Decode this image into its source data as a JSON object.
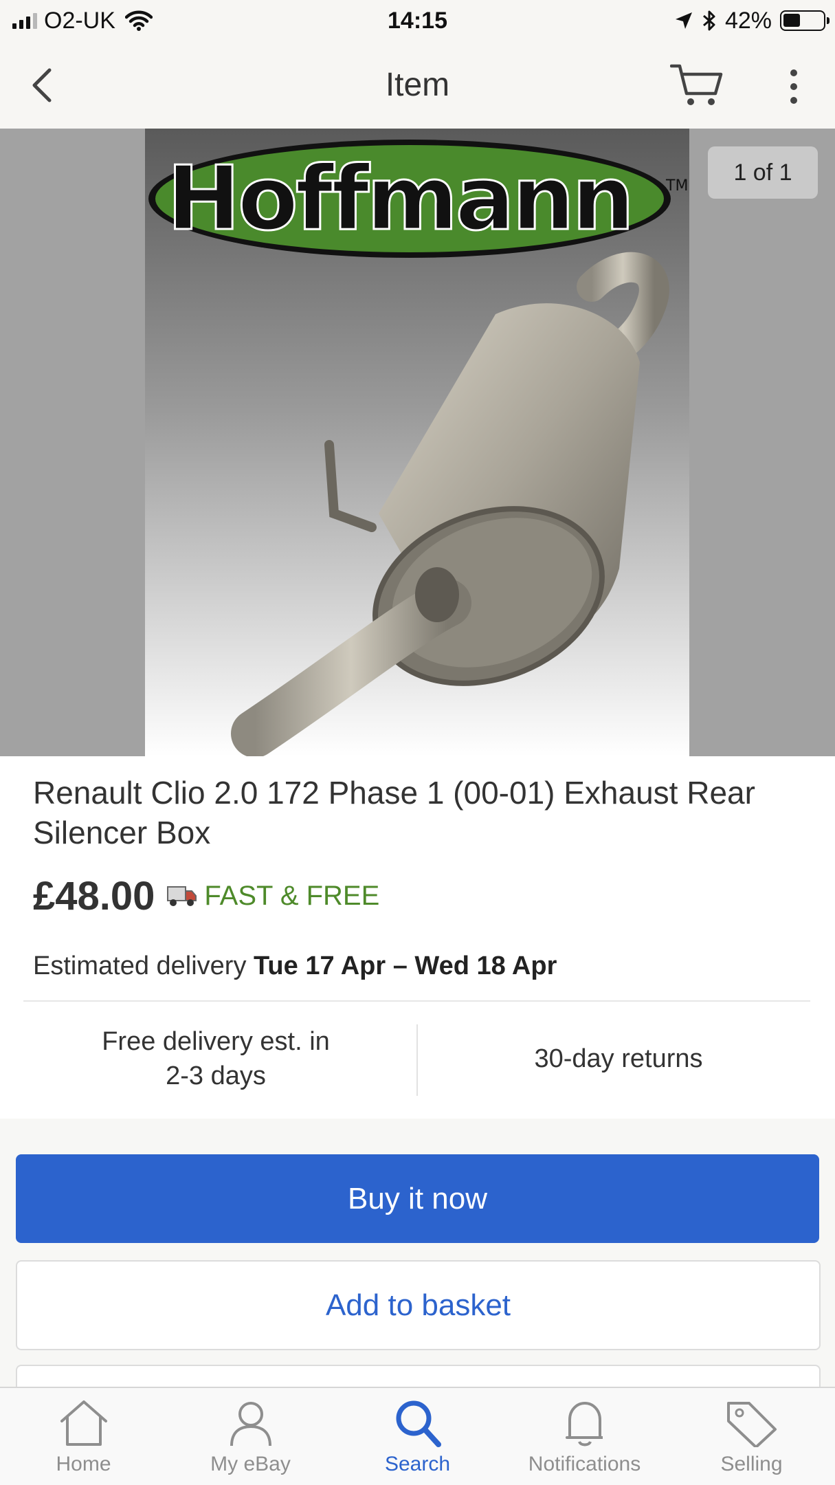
{
  "status_bar": {
    "carrier": "O2-UK",
    "time": "14:15",
    "battery": "42%",
    "battery_level": 0.42,
    "icons": [
      "signal-icon",
      "wifi-icon",
      "location-arrow-icon",
      "bluetooth-icon",
      "battery-icon"
    ]
  },
  "nav": {
    "title": "Item",
    "icons": [
      "back-chevron-icon",
      "cart-icon",
      "more-vertical-icon"
    ]
  },
  "gallery": {
    "counter": "1 of 1",
    "brand": "Hoffmann",
    "trademark": "TM"
  },
  "item": {
    "title": "Renault Clio 2.0 172 Phase 1  (00-01) Exhaust Rear Silencer Box",
    "price": "£48.00",
    "shipping_label": "FAST & FREE",
    "delivery_prefix": "Estimated delivery",
    "delivery_dates": "Tue 17 Apr – Wed 18 Apr",
    "free_delivery_line1": "Free delivery est. in",
    "free_delivery_line2": "2-3 days",
    "returns": "30-day returns"
  },
  "actions": {
    "buy_now": "Buy it now",
    "add_to_basket": "Add to basket"
  },
  "tab_bar": {
    "tabs": [
      {
        "label": "Home",
        "icon": "home-icon",
        "active": false
      },
      {
        "label": "My eBay",
        "icon": "person-icon",
        "active": false
      },
      {
        "label": "Search",
        "icon": "search-icon",
        "active": true
      },
      {
        "label": "Notifications",
        "icon": "bell-icon",
        "active": false
      },
      {
        "label": "Selling",
        "icon": "tag-icon",
        "active": false
      }
    ]
  },
  "colors": {
    "accent_blue": "#2c63cd",
    "shipping_green": "#4e8a2a",
    "logo_green": "#4a8a2c"
  }
}
